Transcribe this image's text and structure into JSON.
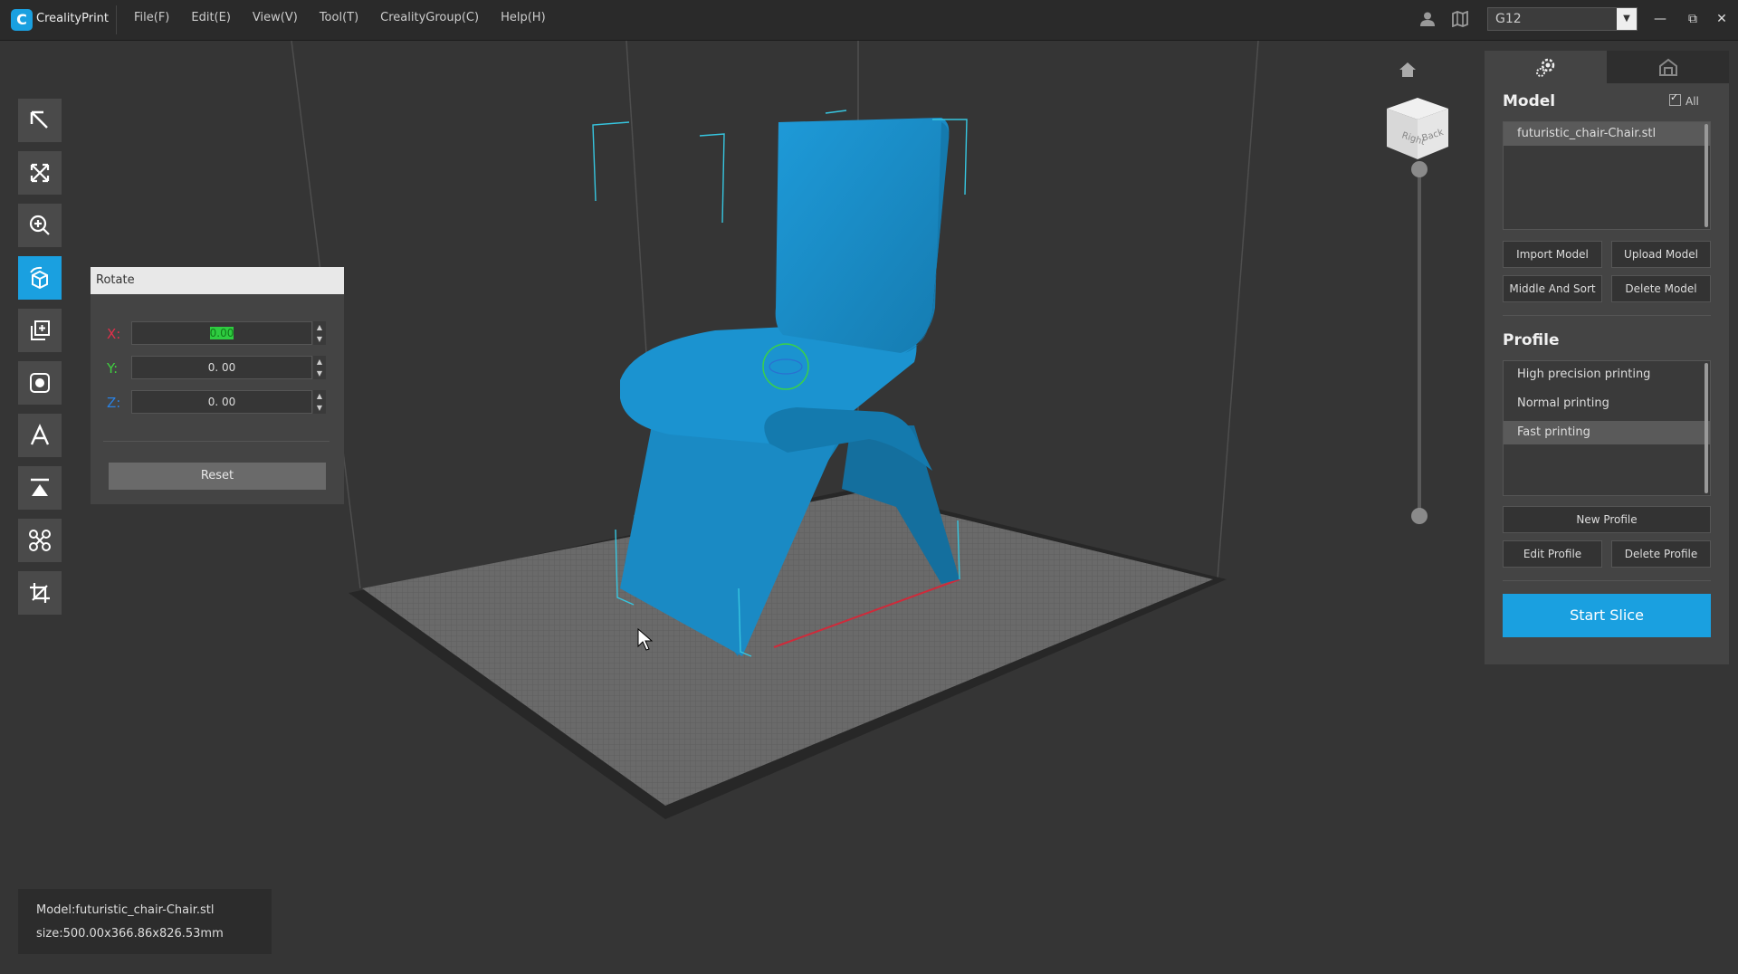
{
  "app": {
    "name": "CrealityPrint",
    "logo_glyph": "C"
  },
  "menu": [
    "File(F)",
    "Edit(E)",
    "View(V)",
    "Tool(T)",
    "CrealityGroup(C)",
    "Help(H)"
  ],
  "printer": {
    "selected": "G12"
  },
  "window_controls": {
    "minimize": "—",
    "restore": "⧉",
    "close": "✕"
  },
  "toolbar": [
    {
      "name": "select-tool",
      "icon": "arrow-select-icon",
      "active": false
    },
    {
      "name": "move-tool",
      "icon": "move-arrows-icon",
      "active": false
    },
    {
      "name": "scale-tool",
      "icon": "zoom-scale-icon",
      "active": false
    },
    {
      "name": "rotate-tool",
      "icon": "rotate-cube-icon",
      "active": true
    },
    {
      "name": "duplicate-tool",
      "icon": "duplicate-icon",
      "active": false
    },
    {
      "name": "support-tool",
      "icon": "support-icon",
      "active": false
    },
    {
      "name": "text-tool",
      "icon": "text-icon",
      "active": false
    },
    {
      "name": "lay-flat-tool",
      "icon": "lay-flat-icon",
      "active": false
    },
    {
      "name": "split-tool",
      "icon": "nodes-icon",
      "active": false
    },
    {
      "name": "cut-tool",
      "icon": "crop-icon",
      "active": false
    }
  ],
  "rotate_panel": {
    "title": "Rotate",
    "x_label": "X:",
    "x_value": "0.00",
    "y_label": "Y:",
    "y_value": "0. 00",
    "z_label": "Z:",
    "z_value": "0. 00",
    "reset_label": "Reset",
    "colors": {
      "x": "#e0304a",
      "y": "#40d040",
      "z": "#2a80e0"
    }
  },
  "view_cube": {
    "right": "Right",
    "back": "Back"
  },
  "right_panel": {
    "model_heading": "Model",
    "all_label": "All",
    "models": [
      "futuristic_chair-Chair.stl"
    ],
    "import_label": "Import Model",
    "upload_label": "Upload Model",
    "middle_sort_label": "Middle And Sort",
    "delete_model_label": "Delete Model",
    "profile_heading": "Profile",
    "profiles": [
      "High precision printing",
      "Normal printing",
      "Fast printing"
    ],
    "selected_profile": 2,
    "new_profile_label": "New Profile",
    "edit_profile_label": "Edit Profile",
    "delete_profile_label": "Delete Profile",
    "start_slice_label": "Start Slice"
  },
  "info": {
    "model_line": "Model:futuristic_chair-Chair.stl",
    "size_line": "size:500.00x366.86x826.53mm"
  },
  "colors": {
    "accent": "#1aa0e0",
    "model": "#1a8fc8",
    "bed": "#6a6a6a",
    "background": "#353535"
  }
}
